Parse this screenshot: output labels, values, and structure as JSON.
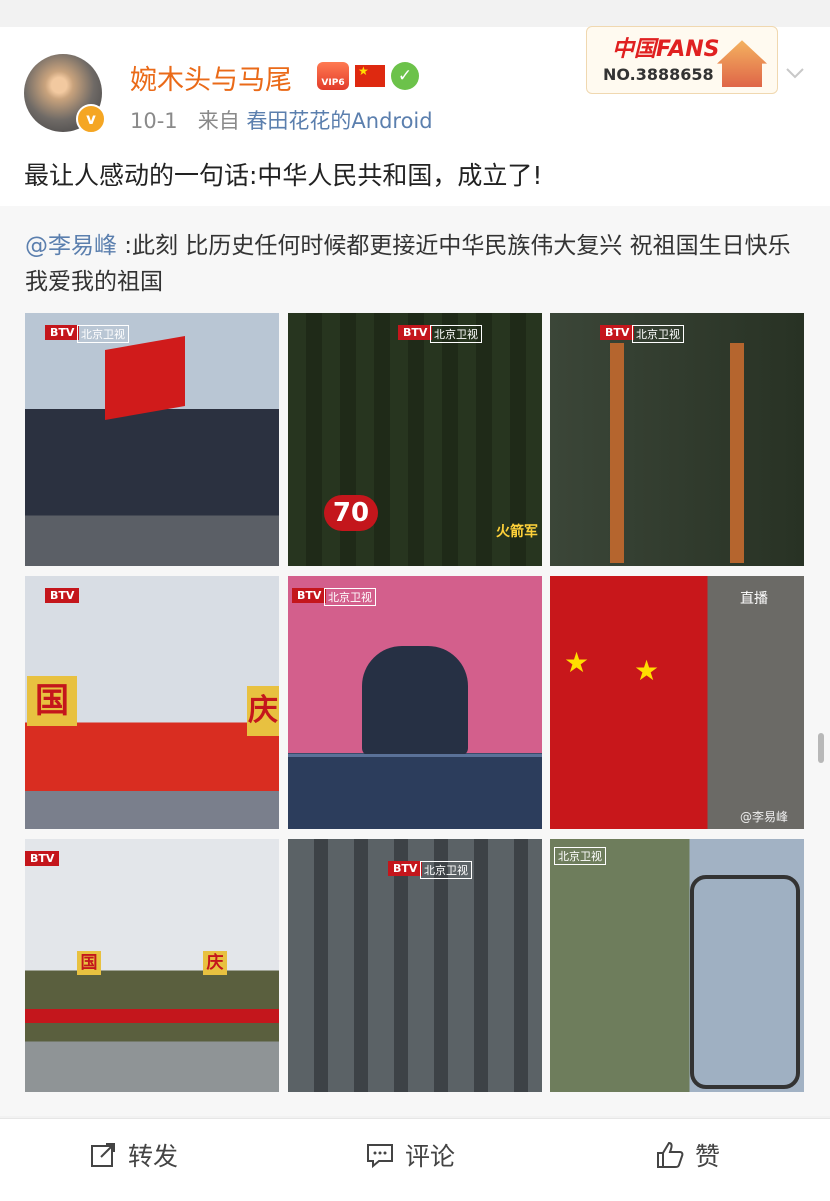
{
  "post": {
    "username": "婉木头与马尾",
    "vip_label": "VIP6",
    "time": "10-1",
    "from_prefix": "来自",
    "source": "春田花花的Android",
    "fans_badge": {
      "title": "中国FANS",
      "number": "NO.3888658"
    },
    "text": "最让人感动的一句话:中华人民共和国，成立了!"
  },
  "repost": {
    "mention": "@李易峰",
    "text": " :此刻 比历史任何时候都更接近中华民族伟大复兴  祝祖国生日快乐 我爱我的祖国",
    "photos": [
      {
        "name": "photo-honor-guard-flag",
        "tv_logo": "BTV",
        "channel": "北京卫视"
      },
      {
        "name": "photo-troops-70",
        "tv_logo": "BTV",
        "channel": "北京卫视",
        "caption": "火箭军"
      },
      {
        "name": "photo-soldiers-rifles",
        "tv_logo": "BTV",
        "channel": "北京卫视"
      },
      {
        "name": "photo-crowd-guo",
        "tv_logo": "BTV",
        "caption_left": "国",
        "caption_right": "庆"
      },
      {
        "name": "photo-leader-car",
        "tv_logo": "BTV",
        "channel": "北京卫视"
      },
      {
        "name": "photo-red-flags",
        "caption": "直播",
        "watermark": "@李易峰"
      },
      {
        "name": "photo-square-wide",
        "tv_logo": "BTV",
        "caption_left": "国",
        "caption_right": "庆"
      },
      {
        "name": "photo-troops-march",
        "tv_logo": "BTV",
        "channel": "北京卫视"
      },
      {
        "name": "photo-soldier-blur",
        "channel": "北京卫视"
      }
    ]
  },
  "actions": {
    "repost_label": "转发",
    "comment_label": "评论",
    "like_label": "赞"
  },
  "colors": {
    "username": "#ea6a18",
    "link": "#5b7fae",
    "muted": "#8a8a8a"
  }
}
